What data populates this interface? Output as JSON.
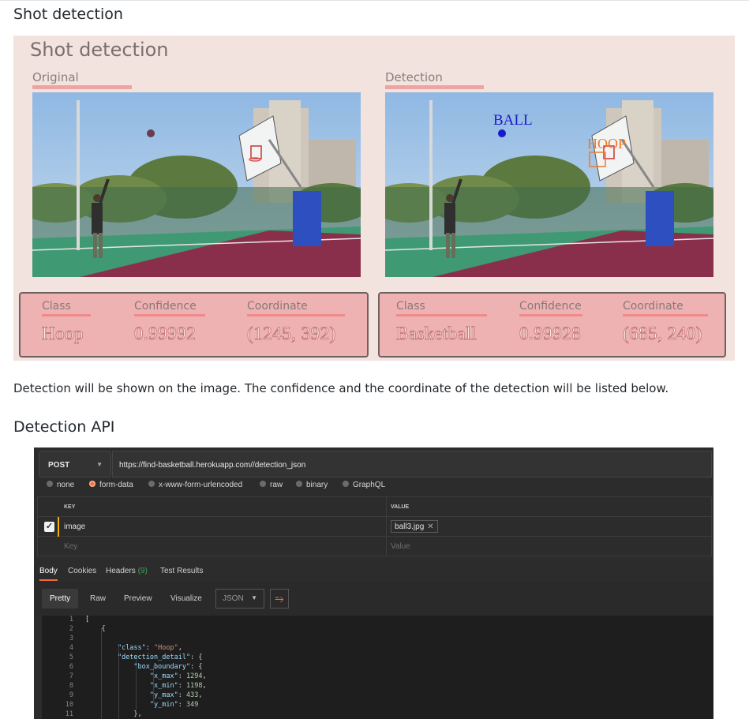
{
  "headings": {
    "shot_detection": "Shot detection",
    "detection_api": "Detection API"
  },
  "slide": {
    "title": "Shot detection",
    "original_label": "Original",
    "detection_label": "Detection",
    "ball_label": "BALL",
    "hoop_label": "HOOP",
    "colors": {
      "ball": "#1a1acc",
      "hoop": "#f07a2a",
      "background": "#f2e3df",
      "result_box": "#eeb2b2"
    },
    "results": [
      {
        "class_header": "Class",
        "confidence_header": "Confidence",
        "coordinate_header": "Coordinate",
        "class": "Hoop",
        "confidence": "0.99992",
        "coordinate": "(1245, 392)"
      },
      {
        "class_header": "Class",
        "confidence_header": "Confidence",
        "coordinate_header": "Coordinate",
        "class": "Basketball",
        "confidence": "0.99928",
        "coordinate": "(685, 240)"
      }
    ]
  },
  "description": "Detection will be shown on the image. The confidence and the coordinate of the detection will be listed below.",
  "postman": {
    "method": "POST",
    "url": "https://find-basketball.herokuapp.com//detection_json",
    "body_options": [
      "none",
      "form-data",
      "x-www-form-urlencoded",
      "raw",
      "binary",
      "GraphQL"
    ],
    "selected_body_option": "form-data",
    "table": {
      "key_header": "KEY",
      "value_header": "VALUE",
      "row_key": "image",
      "row_value": "ball3.jpg",
      "key_placeholder": "Key",
      "value_placeholder": "Value"
    },
    "response_tabs": {
      "body": "Body",
      "cookies": "Cookies",
      "headers": "Headers",
      "headers_count": "(9)",
      "test_results": "Test Results"
    },
    "view_buttons": {
      "pretty": "Pretty",
      "raw": "Raw",
      "preview": "Preview",
      "visualize": "Visualize"
    },
    "format": "JSON",
    "code_lines": [
      {
        "n": "1",
        "text": "["
      },
      {
        "n": "2",
        "text": "    {"
      },
      {
        "n": "3",
        "text": ""
      },
      {
        "n": "4",
        "text": "        \"class\": \"Hoop\","
      },
      {
        "n": "5",
        "text": "        \"detection_detail\": {"
      },
      {
        "n": "6",
        "text": "            \"box_boundary\": {"
      },
      {
        "n": "7",
        "text": "                \"x_max\": 1294,"
      },
      {
        "n": "8",
        "text": "                \"x_min\": 1198,"
      },
      {
        "n": "9",
        "text": "                \"y_max\": 433,"
      },
      {
        "n": "10",
        "text": "                \"y_min\": 349"
      },
      {
        "n": "11",
        "text": "            },"
      }
    ]
  }
}
